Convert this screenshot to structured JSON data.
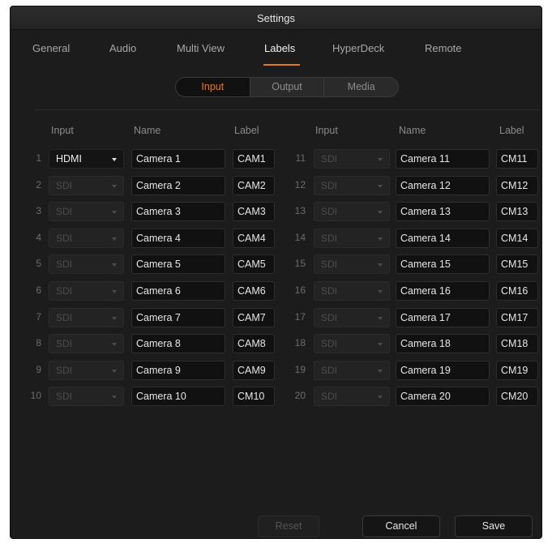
{
  "window": {
    "title": "Settings"
  },
  "tabs": [
    {
      "label": "General",
      "active": false
    },
    {
      "label": "Audio",
      "active": false
    },
    {
      "label": "Multi View",
      "active": false
    },
    {
      "label": "Labels",
      "active": true
    },
    {
      "label": "HyperDeck",
      "active": false
    },
    {
      "label": "Remote",
      "active": false
    }
  ],
  "segments": [
    {
      "label": "Input",
      "selected": true
    },
    {
      "label": "Output",
      "selected": false
    },
    {
      "label": "Media",
      "selected": false
    }
  ],
  "columns": {
    "left": {
      "input": "Input",
      "name": "Name",
      "label": "Label"
    },
    "right": {
      "input": "Input",
      "name": "Name",
      "label": "Label"
    }
  },
  "inputs": [
    {
      "num": "1",
      "source": "HDMI",
      "enabled": true,
      "name": "Camera 1",
      "label": "CAM1"
    },
    {
      "num": "2",
      "source": "SDI",
      "enabled": false,
      "name": "Camera 2",
      "label": "CAM2"
    },
    {
      "num": "3",
      "source": "SDI",
      "enabled": false,
      "name": "Camera 3",
      "label": "CAM3"
    },
    {
      "num": "4",
      "source": "SDI",
      "enabled": false,
      "name": "Camera 4",
      "label": "CAM4"
    },
    {
      "num": "5",
      "source": "SDI",
      "enabled": false,
      "name": "Camera 5",
      "label": "CAM5"
    },
    {
      "num": "6",
      "source": "SDI",
      "enabled": false,
      "name": "Camera 6",
      "label": "CAM6"
    },
    {
      "num": "7",
      "source": "SDI",
      "enabled": false,
      "name": "Camera 7",
      "label": "CAM7"
    },
    {
      "num": "8",
      "source": "SDI",
      "enabled": false,
      "name": "Camera 8",
      "label": "CAM8"
    },
    {
      "num": "9",
      "source": "SDI",
      "enabled": false,
      "name": "Camera 9",
      "label": "CAM9"
    },
    {
      "num": "10",
      "source": "SDI",
      "enabled": false,
      "name": "Camera 10",
      "label": "CM10"
    },
    {
      "num": "11",
      "source": "SDI",
      "enabled": false,
      "name": "Camera 11",
      "label": "CM11"
    },
    {
      "num": "12",
      "source": "SDI",
      "enabled": false,
      "name": "Camera 12",
      "label": "CM12"
    },
    {
      "num": "13",
      "source": "SDI",
      "enabled": false,
      "name": "Camera 13",
      "label": "CM13"
    },
    {
      "num": "14",
      "source": "SDI",
      "enabled": false,
      "name": "Camera 14",
      "label": "CM14"
    },
    {
      "num": "15",
      "source": "SDI",
      "enabled": false,
      "name": "Camera 15",
      "label": "CM15"
    },
    {
      "num": "16",
      "source": "SDI",
      "enabled": false,
      "name": "Camera 16",
      "label": "CM16"
    },
    {
      "num": "17",
      "source": "SDI",
      "enabled": false,
      "name": "Camera 17",
      "label": "CM17"
    },
    {
      "num": "18",
      "source": "SDI",
      "enabled": false,
      "name": "Camera 18",
      "label": "CM18"
    },
    {
      "num": "19",
      "source": "SDI",
      "enabled": false,
      "name": "Camera 19",
      "label": "CM19"
    },
    {
      "num": "20",
      "source": "SDI",
      "enabled": false,
      "name": "Camera 20",
      "label": "CM20"
    }
  ],
  "buttons": {
    "reset": "Reset",
    "cancel": "Cancel",
    "save": "Save"
  },
  "colors": {
    "accent": "#e8791f",
    "background": "#1c1c1c",
    "field": "#111111"
  }
}
